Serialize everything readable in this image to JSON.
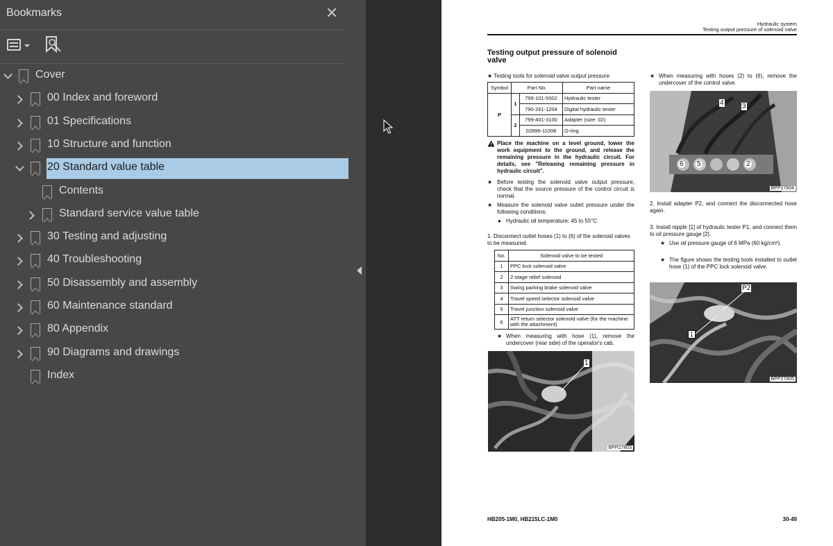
{
  "panel": {
    "title": "Bookmarks",
    "bookmarks": [
      {
        "label": "Cover",
        "level": 0,
        "expander": "down",
        "selected": false
      },
      {
        "label": "00 Index and foreword",
        "level": 1,
        "expander": "right",
        "selected": false
      },
      {
        "label": "01 Specifications",
        "level": 1,
        "expander": "right",
        "selected": false
      },
      {
        "label": "10 Structure and function",
        "level": 1,
        "expander": "right",
        "selected": false
      },
      {
        "label": "20 Standard value table",
        "level": 1,
        "expander": "down",
        "selected": true
      },
      {
        "label": "Contents",
        "level": 2,
        "expander": "none",
        "selected": false
      },
      {
        "label": "Standard service value table",
        "level": 2,
        "expander": "right",
        "selected": false
      },
      {
        "label": "30 Testing and adjusting",
        "level": 1,
        "expander": "right",
        "selected": false
      },
      {
        "label": "40 Troubleshooting",
        "level": 1,
        "expander": "right",
        "selected": false
      },
      {
        "label": "50 Disassembly and assembly",
        "level": 1,
        "expander": "right",
        "selected": false
      },
      {
        "label": "60 Maintenance standard",
        "level": 1,
        "expander": "right",
        "selected": false
      },
      {
        "label": "80 Appendix",
        "level": 1,
        "expander": "right",
        "selected": false
      },
      {
        "label": "90 Diagrams and drawings",
        "level": 1,
        "expander": "right",
        "selected": false
      },
      {
        "label": "Index",
        "level": 1,
        "expander": "none",
        "selected": false
      }
    ]
  },
  "colors": {
    "panel_bg": "#474747",
    "selection": "#a9cbe6",
    "page": "#ffffff",
    "workspace": "#2d2d2d"
  },
  "page": {
    "header_line1": "Hydraulic system",
    "header_line2": "Testing output pressure of solenoid valve",
    "title": "Testing output pressure of solenoid valve",
    "tools_caption": "★  Testing tools for solenoid valve output pressure",
    "tools_table": {
      "headers": [
        "Symbol",
        "Part No.",
        "Part name"
      ],
      "symbol": "P",
      "groups": [
        "1",
        "2"
      ],
      "rows": [
        {
          "part_no": "799-101-5002",
          "part_name": "Hydraulic tester"
        },
        {
          "part_no": "790-261-1204",
          "part_name": "Digital hydraulic tester"
        },
        {
          "part_no": "799-401-3100",
          "part_name": "Adapter (size: 02)"
        },
        {
          "part_no": "02896-11008",
          "part_name": "O-ring"
        }
      ]
    },
    "warning": "Place the machine on a level ground, lower the work equipment to the ground, and release the remaining pressure in the hydraulic circuit. For details, see \"Releasing remaining pressure in hydraulic circuit\".",
    "note_before": "Before testing the solenoid valve output pressure, check that the source pressure of the control circuit is normal.",
    "note_measure": "Measure the solenoid valve outlet pressure under the following conditions:",
    "condition": "Hydraulic oil temperature: 45 to 55°C",
    "step1": "1.  Disconnect outlet hoses (1) to (6) of the solenoid valves to be measured.",
    "valve_table": {
      "headers": [
        "No.",
        "Solenoid valve to be tested"
      ],
      "rows": [
        {
          "no": "1",
          "name": "PPC lock solenoid valve"
        },
        {
          "no": "2",
          "name": "2-stage relief solenoid"
        },
        {
          "no": "3",
          "name": "Swing parking brake solenoid valve"
        },
        {
          "no": "4",
          "name": "Travel speed selector solenoid valve"
        },
        {
          "no": "5",
          "name": "Travel junction solenoid valve"
        },
        {
          "no": "6",
          "name": "ATT return selector solenoid valve (for the machine with the attachment)"
        }
      ]
    },
    "note_hose1": "When measuring with hose (1), remove the undercover (rear side) of the operator's cab.",
    "photo1_caption": "BPP27803",
    "photo1_label": "1",
    "note_hose26": "When measuring with hoses (2) to (6), remove the undercover of the control valve.",
    "photo2_caption": "BPP27804",
    "photo2_labels": [
      "4",
      "3",
      "6",
      "5",
      "2"
    ],
    "step2": "2.  Install adapter P2, and connect the disconnected hose again.",
    "step3": "3.  Install nipple [1] of hydraulic tester P1, and connect them to oil pressure gauge [2].",
    "note_gauge": "Use oil pressure gauge of 6 MPa (60 kg/cm²).",
    "note_figure": "The figure shows the testing tools installed to outlet hose (1) of the PPC lock solenoid valve.",
    "photo3_caption": "BPP27805",
    "photo3_labels": [
      "P2",
      "1"
    ],
    "footer_model": "HB205-1M0, HB215LC-1M0",
    "footer_page": "30-49"
  }
}
